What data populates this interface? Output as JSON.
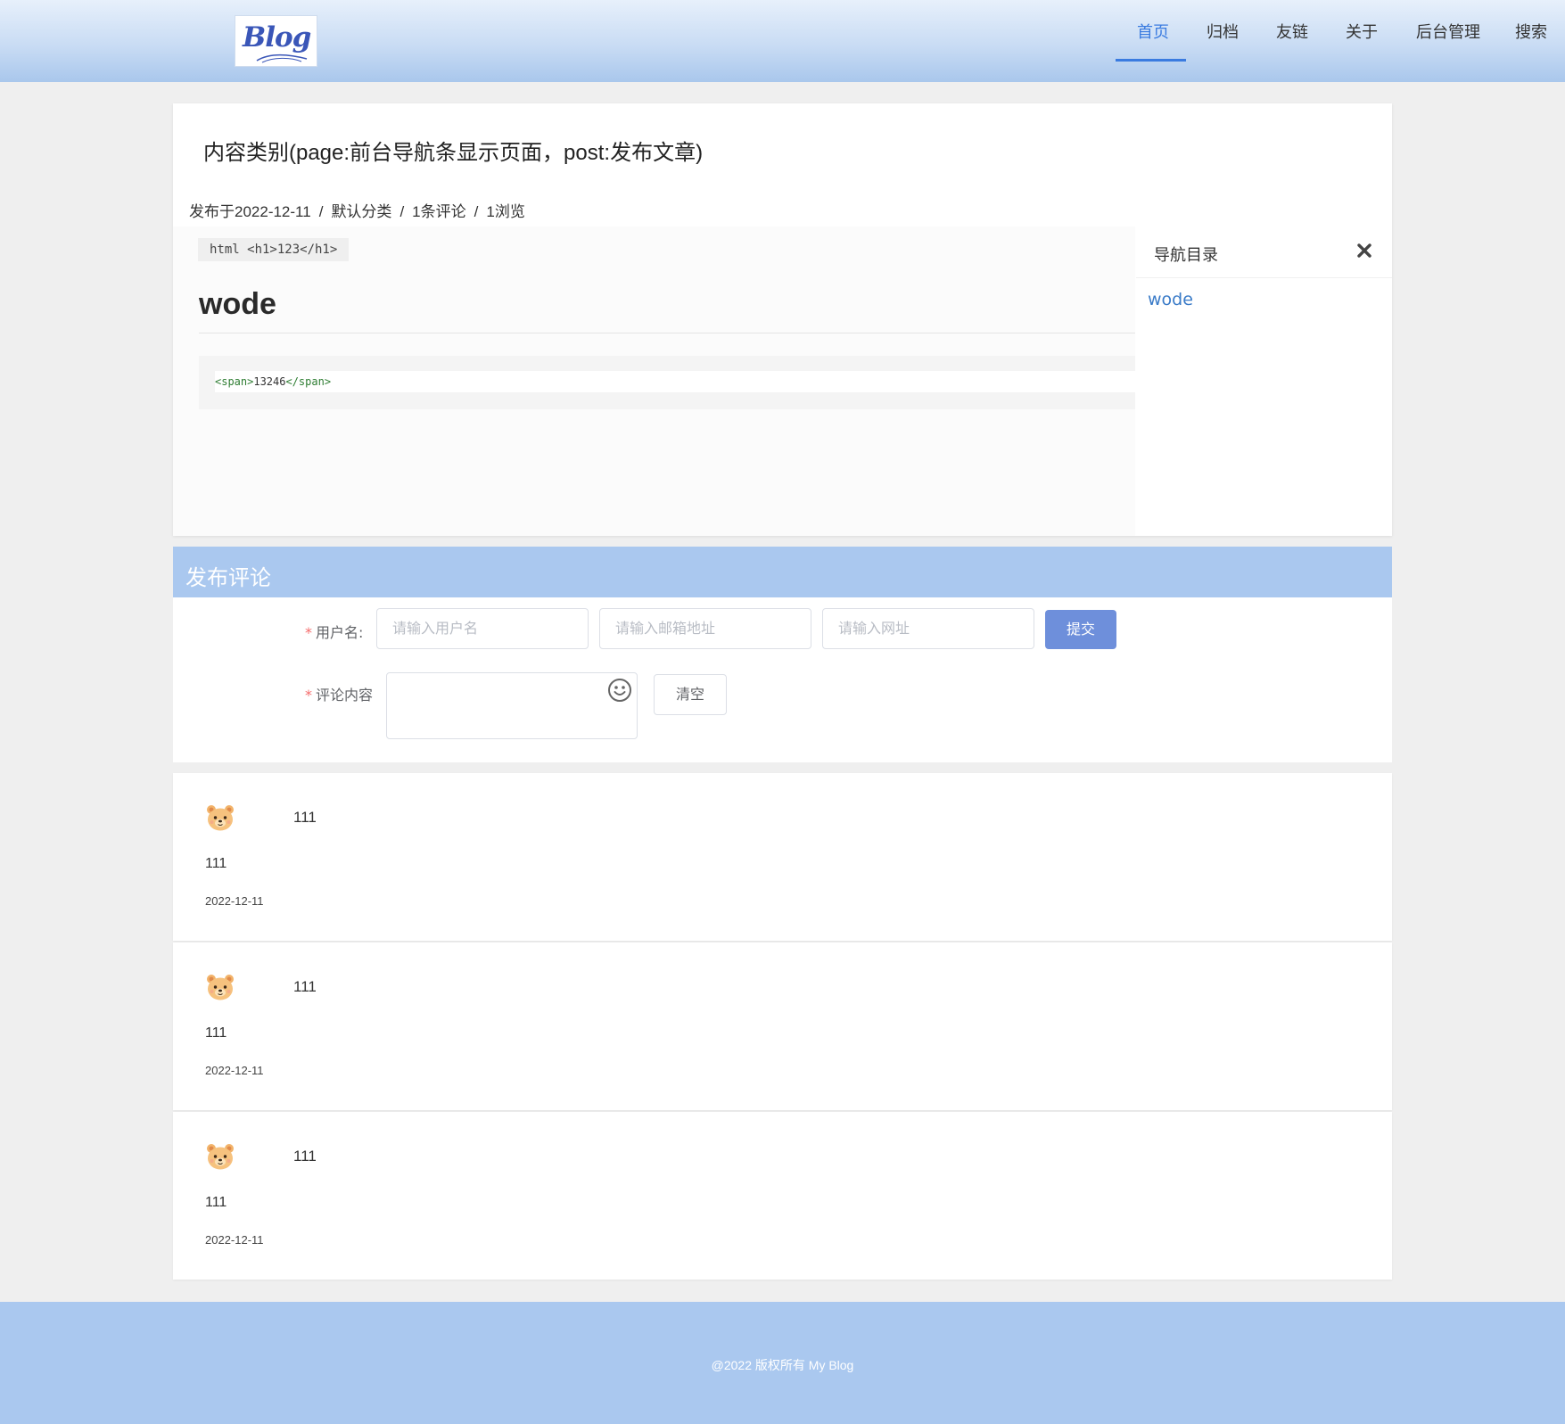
{
  "header": {
    "logo_text": "Blog",
    "nav": [
      {
        "label": "首页",
        "active": true
      },
      {
        "label": "归档",
        "active": false
      },
      {
        "label": "友链",
        "active": false
      },
      {
        "label": "关于",
        "active": false
      },
      {
        "label": "后台管理",
        "active": false
      },
      {
        "label": "搜索",
        "active": false
      }
    ]
  },
  "article": {
    "title": "内容类别(page:前台导航条显示页面，post:发布文章)",
    "meta": {
      "published": "发布于2022-12-11",
      "separator": "/",
      "category": "默认分类",
      "comments": "1条评论",
      "views": "1浏览"
    },
    "inline_code": "html <h1>123</h1>",
    "heading": "wode",
    "code": {
      "open_tag": "<span>",
      "text": "13246",
      "close_tag": "</span>"
    }
  },
  "toc": {
    "title": "导航目录",
    "close_icon": "close-icon",
    "items": [
      "wode"
    ]
  },
  "comment_form": {
    "title": "发布评论",
    "username_label": "用户名:",
    "username_placeholder": "请输入用户名",
    "email_placeholder": "请输入邮箱地址",
    "url_placeholder": "请输入网址",
    "submit_label": "提交",
    "content_label": "评论内容",
    "clear_label": "清空",
    "required_mark": "*",
    "emoji_icon": "smile-icon"
  },
  "comments": [
    {
      "content": "111",
      "name": "111",
      "date": "2022-12-11",
      "avatar": "bear-avatar-icon"
    },
    {
      "content": "111",
      "name": "111",
      "date": "2022-12-11",
      "avatar": "bear-avatar-icon"
    },
    {
      "content": "111",
      "name": "111",
      "date": "2022-12-11",
      "avatar": "bear-avatar-icon"
    }
  ],
  "footer": {
    "text": "@2022  版权所有 My Blog"
  },
  "colors": {
    "accent": "#3a7be0",
    "header_band": "#aac8ef",
    "primary_button": "#6e8fdb",
    "required": "#f56c6c"
  }
}
